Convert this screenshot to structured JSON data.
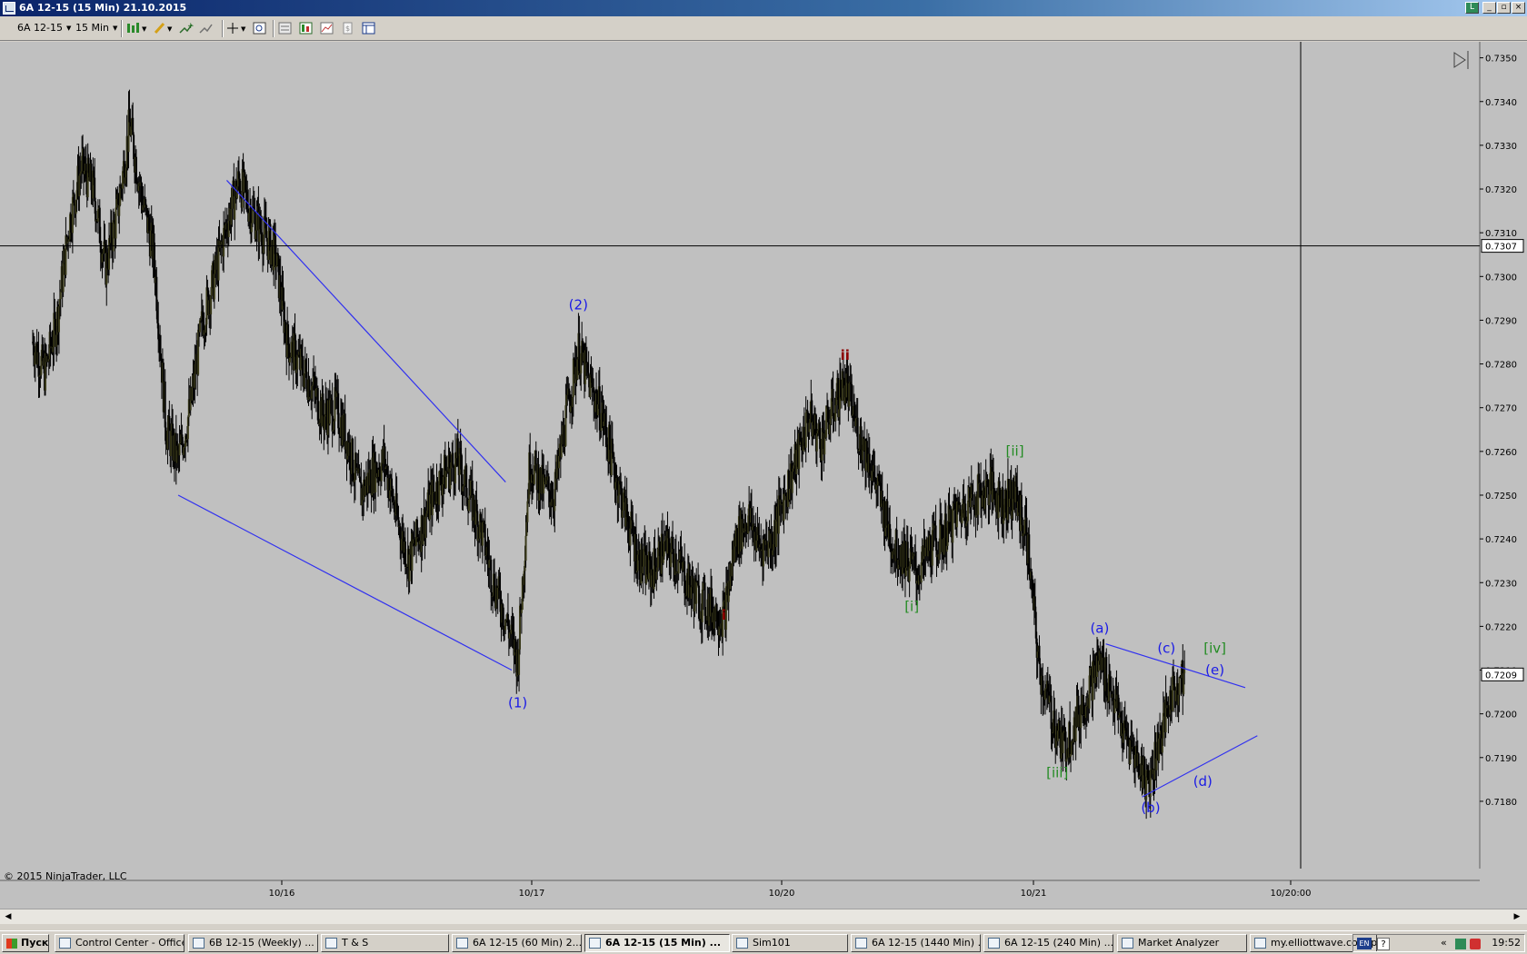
{
  "window": {
    "title": "6A 12-15 (15 Min)  21.10.2015"
  },
  "toolbar": {
    "instrument": "6A 12-15",
    "interval": "15 Min",
    "icons": [
      "bar-type-icon",
      "drawing-pencil-icon",
      "add-indicator-icon",
      "strategy-icon",
      "crosshair-icon",
      "zoom-icon",
      "properties-icon",
      "data-box-icon",
      "chart-trader-icon",
      "copy-icon",
      "layout-icon"
    ]
  },
  "chart_data": {
    "type": "candlestick",
    "instrument": "6A 12-15",
    "interval": "15 Min",
    "ylim": [
      0.7175,
      0.7352
    ],
    "y_ticks": [
      "0.7180",
      "0.7190",
      "0.7200",
      "0.7210",
      "0.7220",
      "0.7230",
      "0.7240",
      "0.7250",
      "0.7260",
      "0.7270",
      "0.7280",
      "0.7290",
      "0.7300",
      "0.7310",
      "0.7320",
      "0.7330",
      "0.7340",
      "0.7350"
    ],
    "x_ticks": [
      "10/16",
      "10/17",
      "10/20",
      "10/21",
      "10/20:00"
    ],
    "crosshair_price": "0.7307",
    "last_price": "0.7209",
    "price_path": [
      [
        0,
        0.7285
      ],
      [
        1,
        0.7278
      ],
      [
        2,
        0.729
      ],
      [
        3,
        0.7312
      ],
      [
        4,
        0.7325
      ],
      [
        5,
        0.732
      ],
      [
        6,
        0.7302
      ],
      [
        7,
        0.7315
      ],
      [
        8,
        0.7335
      ],
      [
        9,
        0.7318
      ],
      [
        10,
        0.7305
      ],
      [
        11,
        0.7265
      ],
      [
        12,
        0.7258
      ],
      [
        13,
        0.727
      ],
      [
        14,
        0.729
      ],
      [
        15,
        0.73
      ],
      [
        16,
        0.7312
      ],
      [
        17,
        0.7322
      ],
      [
        18,
        0.7315
      ],
      [
        19,
        0.731
      ],
      [
        20,
        0.7305
      ],
      [
        21,
        0.7285
      ],
      [
        22,
        0.728
      ],
      [
        23,
        0.7275
      ],
      [
        24,
        0.7268
      ],
      [
        25,
        0.727
      ],
      [
        26,
        0.7262
      ],
      [
        27,
        0.725
      ],
      [
        28,
        0.7255
      ],
      [
        29,
        0.7258
      ],
      [
        30,
        0.7245
      ],
      [
        31,
        0.7235
      ],
      [
        32,
        0.7242
      ],
      [
        33,
        0.725
      ],
      [
        34,
        0.7255
      ],
      [
        35,
        0.7258
      ],
      [
        36,
        0.725
      ],
      [
        37,
        0.7242
      ],
      [
        38,
        0.723
      ],
      [
        39,
        0.7222
      ],
      [
        40,
        0.7212
      ],
      [
        41,
        0.7258
      ],
      [
        42,
        0.7252
      ],
      [
        43,
        0.725
      ],
      [
        44,
        0.7268
      ],
      [
        45,
        0.7283
      ],
      [
        46,
        0.7275
      ],
      [
        47,
        0.7268
      ],
      [
        48,
        0.7255
      ],
      [
        49,
        0.7245
      ],
      [
        50,
        0.7235
      ],
      [
        51,
        0.7232
      ],
      [
        52,
        0.7238
      ],
      [
        53,
        0.7236
      ],
      [
        54,
        0.723
      ],
      [
        55,
        0.7226
      ],
      [
        56,
        0.7224
      ],
      [
        57,
        0.7222
      ],
      [
        58,
        0.724
      ],
      [
        59,
        0.7245
      ],
      [
        60,
        0.7238
      ],
      [
        61,
        0.724
      ],
      [
        62,
        0.725
      ],
      [
        63,
        0.7258
      ],
      [
        64,
        0.7268
      ],
      [
        65,
        0.7262
      ],
      [
        66,
        0.727
      ],
      [
        67,
        0.7276
      ],
      [
        68,
        0.7265
      ],
      [
        69,
        0.7258
      ],
      [
        70,
        0.7248
      ],
      [
        71,
        0.7238
      ],
      [
        72,
        0.7236
      ],
      [
        73,
        0.7232
      ],
      [
        74,
        0.7238
      ],
      [
        75,
        0.724
      ],
      [
        76,
        0.7245
      ],
      [
        77,
        0.7248
      ],
      [
        78,
        0.725
      ],
      [
        79,
        0.7252
      ],
      [
        80,
        0.7248
      ],
      [
        81,
        0.725
      ],
      [
        82,
        0.724
      ],
      [
        83,
        0.721
      ],
      [
        84,
        0.72
      ],
      [
        85,
        0.7192
      ],
      [
        86,
        0.7198
      ],
      [
        87,
        0.7205
      ],
      [
        88,
        0.7212
      ],
      [
        89,
        0.7205
      ],
      [
        90,
        0.7195
      ],
      [
        91,
        0.719
      ],
      [
        92,
        0.7184
      ],
      [
        93,
        0.7195
      ],
      [
        94,
        0.7205
      ],
      [
        95,
        0.7209
      ]
    ],
    "annotations": [
      {
        "text": "(1)",
        "color": "#1a1ae6",
        "x": 40.0,
        "y": 0.72015
      },
      {
        "text": "(2)",
        "color": "#1a1ae6",
        "x": 45.0,
        "y": 0.72925
      },
      {
        "text": "i",
        "color": "#8b0000",
        "x": 57.0,
        "y": 0.72215
      },
      {
        "text": "ii",
        "color": "#8b0000",
        "x": 67.0,
        "y": 0.7281
      },
      {
        "text": "[ii]",
        "color": "#228b22",
        "x": 81.0,
        "y": 0.7259
      },
      {
        "text": "[i]",
        "color": "#228b22",
        "x": 72.5,
        "y": 0.72235
      },
      {
        "text": "[iii]",
        "color": "#228b22",
        "x": 84.5,
        "y": 0.71855
      },
      {
        "text": "(a)",
        "color": "#1a1ae6",
        "x": 88.0,
        "y": 0.72185
      },
      {
        "text": "(b)",
        "color": "#1a1ae6",
        "x": 92.2,
        "y": 0.71775
      },
      {
        "text": "(c)",
        "color": "#1a1ae6",
        "x": 93.5,
        "y": 0.7214
      },
      {
        "text": "(d)",
        "color": "#1a1ae6",
        "x": 96.5,
        "y": 0.71835
      },
      {
        "text": "(e)",
        "color": "#1a1ae6",
        "x": 97.5,
        "y": 0.7209
      },
      {
        "text": "[iv]",
        "color": "#228b22",
        "x": 97.5,
        "y": 0.7214
      }
    ],
    "trendlines": [
      {
        "color": "#3030f0",
        "from": [
          16.0,
          0.7322
        ],
        "to": [
          39.0,
          0.7253
        ]
      },
      {
        "color": "#3030f0",
        "from": [
          12.0,
          0.725
        ],
        "to": [
          39.5,
          0.721
        ]
      },
      {
        "color": "#3030f0",
        "from": [
          88.5,
          0.7216
        ],
        "to": [
          100.0,
          0.7206
        ]
      },
      {
        "color": "#3030f0",
        "from": [
          91.5,
          0.7181
        ],
        "to": [
          101.0,
          0.7195
        ]
      }
    ],
    "grid": false
  },
  "copyright": "© 2015 NinjaTrader, LLC",
  "taskbar": {
    "start": "Пуск",
    "tasks": [
      {
        "label": "Control Center - Office",
        "active": false
      },
      {
        "label": "6B 12-15 (Weekly)  ...",
        "active": false
      },
      {
        "label": "T & S",
        "active": false
      },
      {
        "label": "6A 12-15 (60 Min)  2...",
        "active": false
      },
      {
        "label": "6A 12-15 (15 Min) ...",
        "active": true
      },
      {
        "label": "Sim101",
        "active": false
      },
      {
        "label": "6A 12-15 (1440 Min) ...",
        "active": false
      },
      {
        "label": "6A 12-15 (240 Min) ...",
        "active": false
      },
      {
        "label": "Market Analyzer",
        "active": false
      },
      {
        "label": "my.elliottwave.com/p...",
        "active": false
      }
    ],
    "tray": {
      "lang": "EN",
      "time": "19:52"
    }
  }
}
